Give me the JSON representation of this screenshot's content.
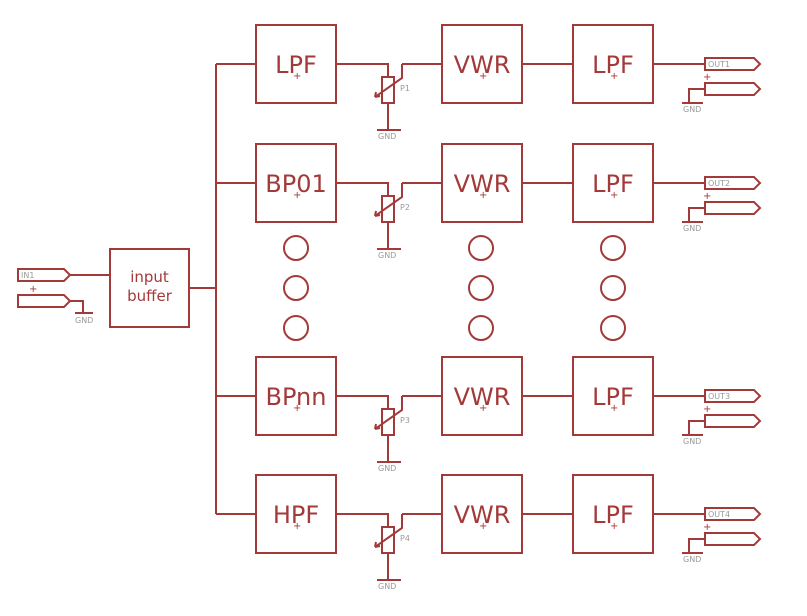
{
  "colors": {
    "wire": "#a33a3a",
    "label": "#999999",
    "background": "#ffffff"
  },
  "input": {
    "port": "IN1",
    "gnd": "GND",
    "buffer_line1": "input",
    "buffer_line2": "buffer"
  },
  "rows": [
    {
      "filter": "LPF",
      "pot": "P1",
      "detector": "VWR",
      "smoother": "LPF",
      "out": "OUT1",
      "gnd_pot": "GND",
      "gnd_out": "GND"
    },
    {
      "filter": "BP01",
      "pot": "P2",
      "detector": "VWR",
      "smoother": "LPF",
      "out": "OUT2",
      "gnd_pot": "GND",
      "gnd_out": "GND"
    },
    {
      "filter": "BPnn",
      "pot": "P3",
      "detector": "VWR",
      "smoother": "LPF",
      "out": "OUT3",
      "gnd_pot": "GND",
      "gnd_out": "GND"
    },
    {
      "filter": "HPF",
      "pot": "P4",
      "detector": "VWR",
      "smoother": "LPF",
      "out": "OUT4",
      "gnd_pot": "GND",
      "gnd_out": "GND"
    }
  ],
  "ellipsis": "continuation-dots"
}
